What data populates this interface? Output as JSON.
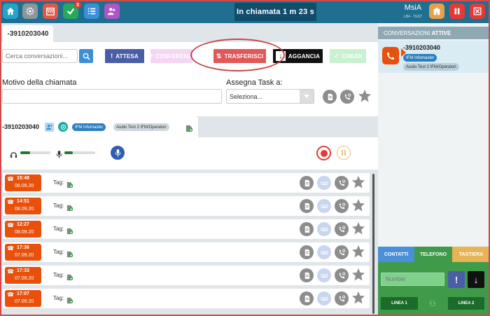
{
  "header": {
    "call_status": "In chiamata  1 m 23 s",
    "user_name": "MsiA",
    "user_sub": "LB4 - TEST",
    "notifications_badge": "3"
  },
  "tab": {
    "label": "-3910203040"
  },
  "toolbar": {
    "search_placeholder": "Cerca conversazioni...",
    "attesa": "ATTESA",
    "conferenza": "CONFERENZA",
    "trasferisci": "TRASFERISCI",
    "aggancia": "AGGANCIA",
    "chiudi": "CHIUDI"
  },
  "form": {
    "motivo_label": "Motivo della chiamata",
    "assegna_label": "Assegna Task a:",
    "select_value": "Seleziona..."
  },
  "call": {
    "number": "-3910203040",
    "tag1": "IFM Infomaster",
    "tag2": "Audio Test 2 IFM/Operatori",
    "headset_level": 0.33,
    "mic_level": 0.27
  },
  "history": [
    {
      "time": "15:48",
      "date": "08.09.20",
      "tag_label": "Tag:"
    },
    {
      "time": "14:51",
      "date": "08.09.20",
      "tag_label": "Tag:"
    },
    {
      "time": "12:27",
      "date": "08.09.20",
      "tag_label": "Tag:"
    },
    {
      "time": "17:36",
      "date": "07.09.20",
      "tag_label": "Tag:"
    },
    {
      "time": "17:33",
      "date": "07.09.20",
      "tag_label": "Tag:"
    },
    {
      "time": "17:07",
      "date": "07.09.20",
      "tag_label": "Tag:"
    }
  ],
  "right_panel": {
    "header_prefix": "CONVERSAZIONI",
    "header_strong": "ATTIVE",
    "active_number": "-3910203040",
    "active_tag1": "IFM Infomaster",
    "active_tag2": "Audio Test 2 IFM/Operatori",
    "tabs": {
      "contatti": "CONTATTI",
      "telefono": "TELEFONO",
      "tastiera": "TASTIERA"
    },
    "number_placeholder": "Number",
    "linea1": "LINEA 1",
    "linea2": "LINEA 2"
  },
  "colors": {
    "topbar": "#1e6f90",
    "orange": "#e8500b",
    "attesa": "#4a5ea8",
    "trasferisci": "#e05858",
    "green": "#3f9a4a"
  }
}
